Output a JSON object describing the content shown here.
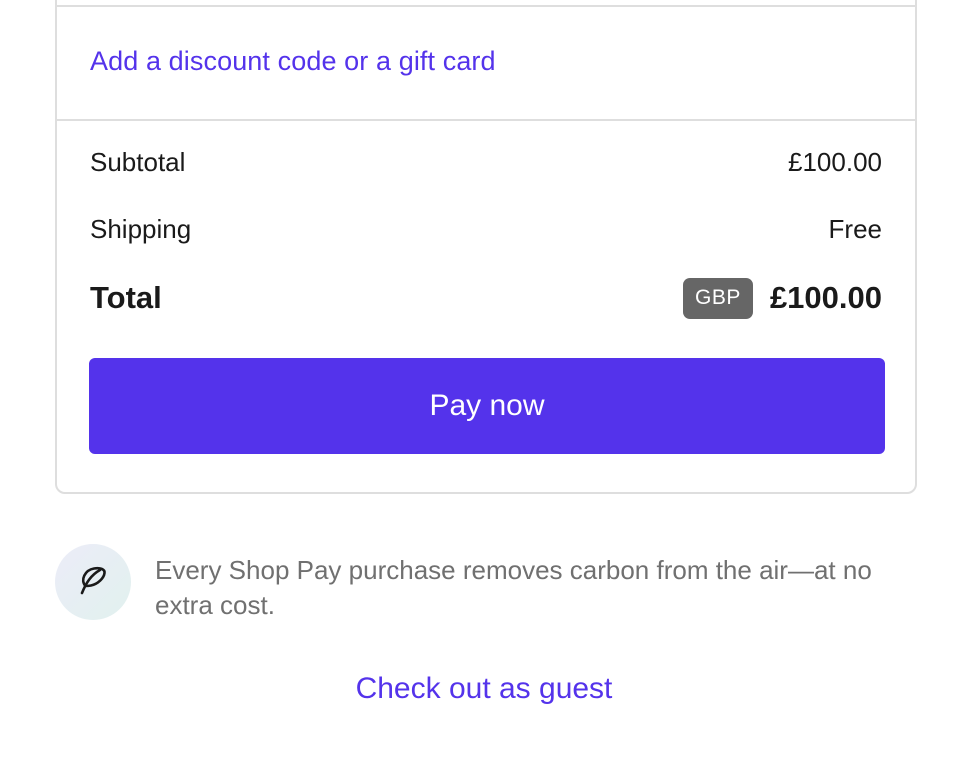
{
  "order_summary": {
    "discount_link": "Add a discount code or a gift card",
    "subtotal_label": "Subtotal",
    "subtotal_value": "£100.00",
    "shipping_label": "Shipping",
    "shipping_value": "Free",
    "total_label": "Total",
    "currency": "GBP",
    "total_value": "£100.00",
    "pay_button": "Pay now"
  },
  "carbon_note": {
    "icon": "leaf-icon",
    "text": "Every Shop Pay purchase removes carbon from the air—at no extra cost."
  },
  "guest_link": "Check out as guest",
  "colors": {
    "accent": "#5433eb",
    "badge": "#666666",
    "border": "#dedede",
    "muted_text": "#707070"
  }
}
